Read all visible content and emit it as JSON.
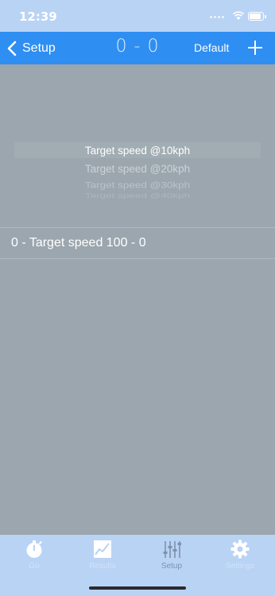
{
  "status_bar": {
    "time": "12:39"
  },
  "nav": {
    "back_label": "Setup",
    "title": "0 - 0",
    "default_label": "Default"
  },
  "picker": {
    "options": [
      "Target speed @10kph",
      "Target speed @20kph",
      "Target speed @30kph",
      "Target speed @40kph"
    ],
    "selected_index": 0
  },
  "list": {
    "items": [
      {
        "label": "0 - Target speed 100 - 0"
      }
    ]
  },
  "tab_bar": {
    "tabs": [
      {
        "label": "Go",
        "icon": "stopwatch-icon",
        "active": false
      },
      {
        "label": "Results",
        "icon": "chart-icon",
        "active": false
      },
      {
        "label": "Setup",
        "icon": "sliders-icon",
        "active": true
      },
      {
        "label": "Settings",
        "icon": "gear-icon",
        "active": false
      }
    ]
  },
  "colors": {
    "nav_bar": "#2f8ef2",
    "status_bar": "#b9d3f5",
    "overlay": "#9ba6ae"
  }
}
